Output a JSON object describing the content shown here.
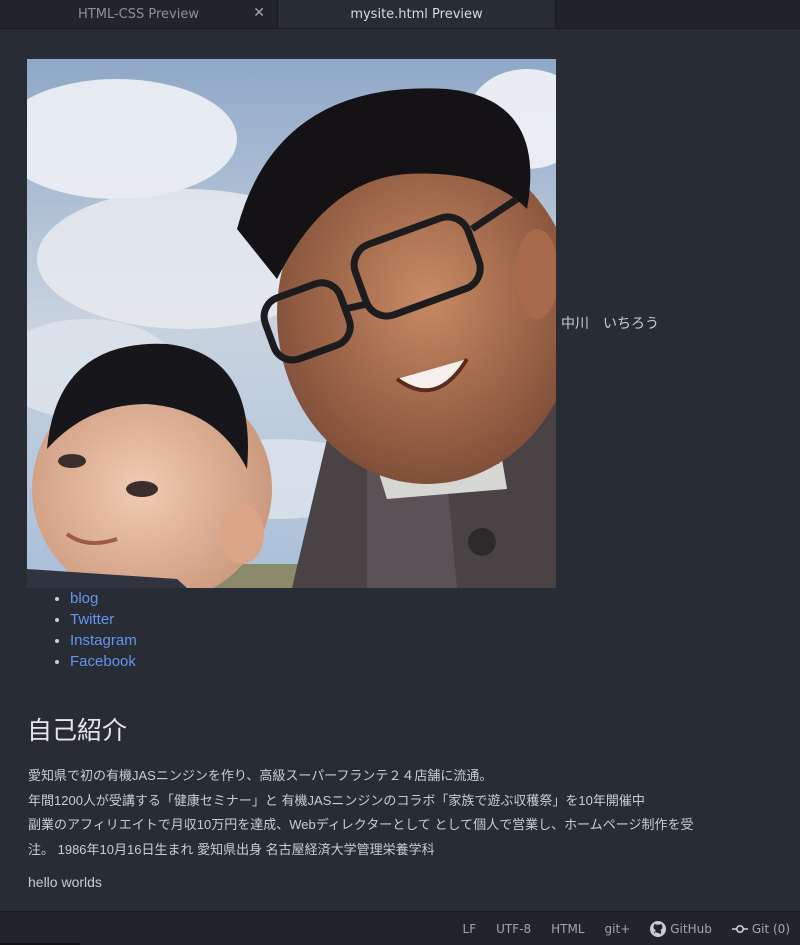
{
  "tabs": [
    {
      "label": "HTML-CSS Preview",
      "active": false,
      "closable": true
    },
    {
      "label": "mysite.html Preview",
      "active": true,
      "closable": false
    }
  ],
  "profile": {
    "photo_icon": "profile-photo",
    "name": "中川　いちろう"
  },
  "links": [
    "blog",
    "Twitter",
    "Instagram",
    "Facebook"
  ],
  "intro": {
    "heading": "自己紹介",
    "lines": [
      "愛知県で初の有機JASニンジンを作り、高級スーパーフランテ２４店舗に流通。",
      "年間1200人が受講する「健康セミナー」と 有機JASニンジンのコラボ「家族で遊ぶ収穫祭」を10年開催中",
      "副業のアフィリエイトで月収10万円を達成、Webディレクターとして として個人で営業し、ホームページ制作を受",
      "注。 1986年10月16日生まれ 愛知県出身 名古屋経済大学管理栄養学科"
    ],
    "footer_text": "hello worlds"
  },
  "statusbar": {
    "line_ending": "LF",
    "encoding": "UTF-8",
    "grammar": "HTML",
    "git_plus": "git+",
    "github": "GitHub",
    "git": "Git (0)"
  },
  "colors": {
    "background": "#282c34",
    "link": "#6494ed",
    "text": "#c8ccd4"
  }
}
